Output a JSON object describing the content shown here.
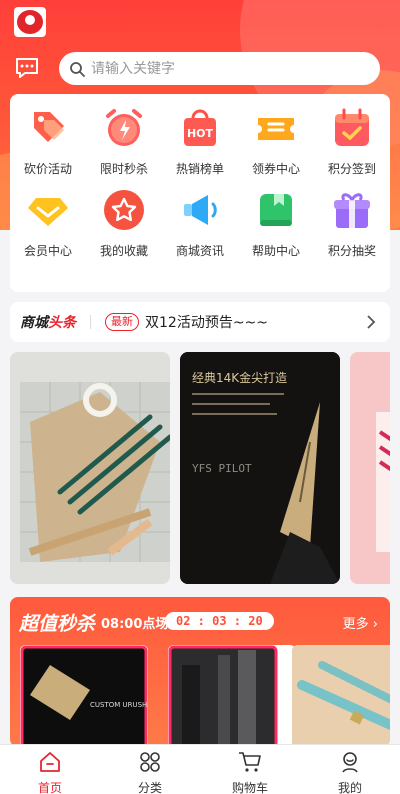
{
  "search": {
    "placeholder": "请输入关键字"
  },
  "grid": [
    {
      "label": "砍价活动",
      "icon": "price-tag-icon"
    },
    {
      "label": "限时秒杀",
      "icon": "alarm-clock-icon"
    },
    {
      "label": "热销榜单",
      "icon": "hot-bag-icon"
    },
    {
      "label": "领券中心",
      "icon": "coupon-icon"
    },
    {
      "label": "积分签到",
      "icon": "calendar-check-icon"
    },
    {
      "label": "会员中心",
      "icon": "diamond-icon"
    },
    {
      "label": "我的收藏",
      "icon": "star-icon"
    },
    {
      "label": "商城资讯",
      "icon": "megaphone-icon"
    },
    {
      "label": "帮助中心",
      "icon": "bookmark-book-icon"
    },
    {
      "label": "积分抽奖",
      "icon": "gift-icon"
    }
  ],
  "news": {
    "brand_a": "商城",
    "brand_b": "头条",
    "badge": "最新",
    "text": "双12活动预告~~~"
  },
  "banners": {
    "b2_title": "经典14K金尖打造",
    "b2_brand": "YFS PILOT"
  },
  "seckill": {
    "title": "超值秒杀",
    "time": "08:00点场",
    "countdown": "02 : 03 : 20",
    "more": "更多"
  },
  "tabs": [
    {
      "label": "首页",
      "icon": "home-icon"
    },
    {
      "label": "分类",
      "icon": "category-icon"
    },
    {
      "label": "购物车",
      "icon": "cart-icon"
    },
    {
      "label": "我的",
      "icon": "user-icon"
    }
  ],
  "colors": {
    "accent": "#e8242d",
    "hero": "#ff4a3a"
  }
}
